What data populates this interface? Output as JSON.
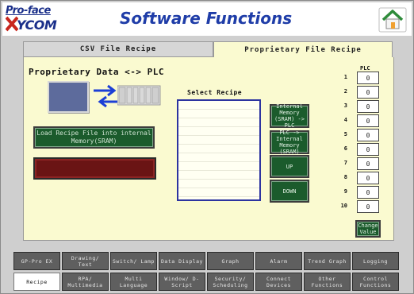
{
  "header": {
    "logo_line1": "Pro-face",
    "logo_line2": "YCOM",
    "title": "Software Functions",
    "home_icon": "home-icon"
  },
  "tabs": [
    {
      "label": "CSV File Recipe",
      "active": false
    },
    {
      "label": "Proprietary File Recipe",
      "active": true
    }
  ],
  "panel": {
    "title": "Proprietary Data <-> PLC",
    "load_button": "Load Recipe File into internal Memory(SRAM)",
    "select_label": "Select Recipe",
    "buttons": {
      "to_plc": "Internal Memory (SRAM) -> PLC",
      "to_sram": "PLC -> Internal Memory (SRAM)",
      "up": "UP",
      "down": "DOWN"
    },
    "plc": {
      "label": "PLC",
      "rows": [
        {
          "num": "1",
          "value": "0"
        },
        {
          "num": "2",
          "value": "0"
        },
        {
          "num": "3",
          "value": "0"
        },
        {
          "num": "4",
          "value": "0"
        },
        {
          "num": "5",
          "value": "0"
        },
        {
          "num": "6",
          "value": "0"
        },
        {
          "num": "7",
          "value": "0"
        },
        {
          "num": "8",
          "value": "0"
        },
        {
          "num": "9",
          "value": "0"
        },
        {
          "num": "10",
          "value": "0"
        }
      ],
      "change_button": "Change Value"
    }
  },
  "nav": {
    "row1": [
      "GP-Pro EX",
      "Drawing/ Text",
      "Switch/ Lamp",
      "Data Display",
      "Graph",
      "Alarm",
      "Trend Graph",
      "Logging"
    ],
    "row2": [
      "Recipe",
      "RPA/ Multimedia",
      "Multi Language",
      "Window/ D-Script",
      "Security/ Scheduling",
      "Connect Devices",
      "Other Functions",
      "Control Functions"
    ],
    "active": "Recipe"
  }
}
